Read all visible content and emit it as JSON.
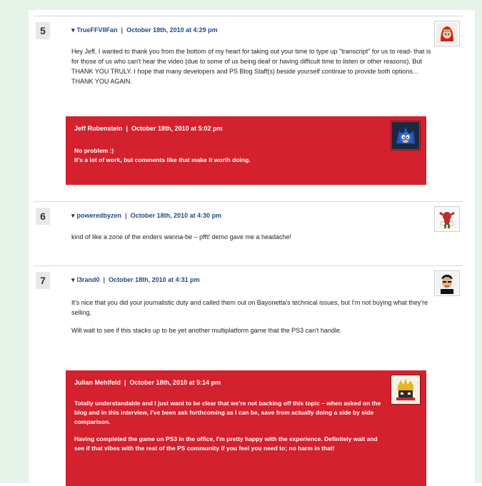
{
  "comments": [
    {
      "number": "5",
      "author": "TrueFFVIIFan",
      "date": "October 18th, 2010 at 4:29 pm",
      "avatar_icon": "red-hood-avatar-icon",
      "body": [
        "Hey Jeff, I wanted to thank you from the bottom of my heart for taking out your time to type up \"transcript\" for us to read- that is for those of us who can't hear the video (due to some of us being deaf or having difficult time to listen or other reasons). But THANK YOU TRULY. I hope that many developers and PS Blog Staff(s) beside yourself continue to provide both options… THANK YOU AGAIN."
      ],
      "reply": {
        "author": "Jeff Rubenstein",
        "date": "October 18th, 2010 at 5:02 pm",
        "avatar_icon": "sonic-avatar-icon",
        "body": [
          "No problem :)\nIt's a lot of work, but comments like that make it worth doing."
        ]
      }
    },
    {
      "number": "6",
      "author": "poweredbyzen",
      "date": "October 18th, 2010 at 4:30 pm",
      "avatar_icon": "knuckles-avatar-icon",
      "body": [
        "kind of like a zone of the enders wanna-be – pfft! demo gave me a headache!"
      ]
    },
    {
      "number": "7",
      "author": "l3rand0",
      "date": "October 18th, 2010 at 4:31 pm",
      "avatar_icon": "face-avatar-icon",
      "body": [
        "It's nice that you did your journalistic duty and called them out on Bayonetta's technical issues, but I'm not buying what they're selling.",
        "Will wait to see if this stacks up to be yet another multiplatform game that the PS3 can't handle."
      ],
      "reply": {
        "author": "Julian Mehlfeld",
        "date": "October 18th, 2010 at 5:14 pm",
        "avatar_icon": "king-avatar-icon",
        "body": [
          "Totally understandable and I just want to be clear that we're not backing off this topic – when asked on the blog and in this interview, I've been ask forthcoming as I can be, save from actually doing a side by side comparison.",
          "Having completed the game on PS3 in the office, I'm pretty happy with the experience. Definitely wait and see if that vibes with the rest of the PS community if you feel you need to; no harm in that!"
        ]
      }
    }
  ],
  "separator": "|",
  "caret": "▾",
  "colors": {
    "reply_background": "#d3212d",
    "author_link": "#1c4a8a",
    "page_margin": "#e5f3e8"
  }
}
